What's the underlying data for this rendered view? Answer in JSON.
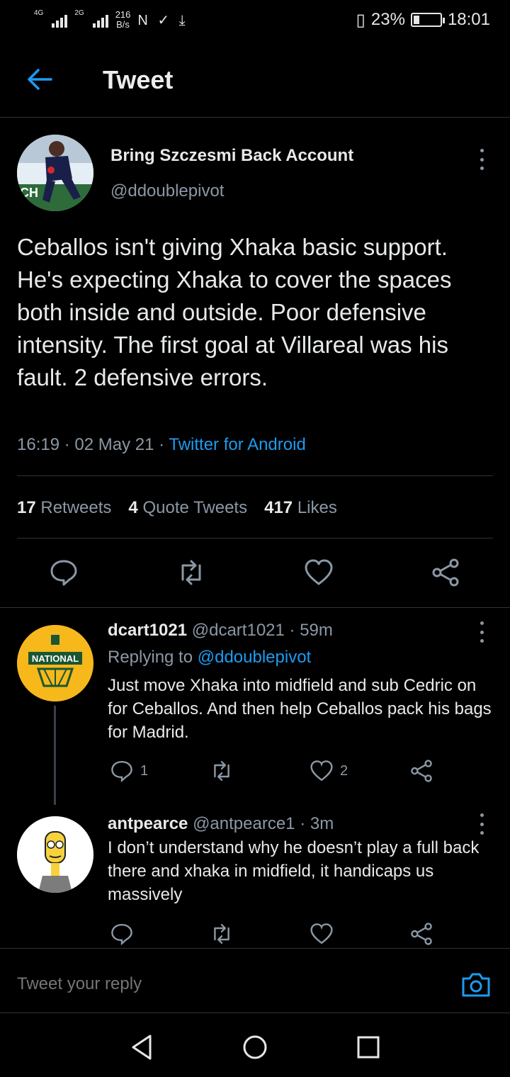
{
  "status_bar": {
    "signal_1": "4G",
    "signal_2": "2G",
    "net_speed": "216",
    "net_unit": "B/s",
    "notif_icons": "N ✓ ⤓",
    "battery_percent": "23%",
    "battery_level": 0.23,
    "time": "18:01"
  },
  "header": {
    "title": "Tweet"
  },
  "tweet": {
    "author_name": "Bring Szczesmi Back Account",
    "author_handle": "@ddoublepivot",
    "text": "Ceballos isn't giving Xhaka basic support. He's expecting Xhaka to cover the spaces both inside and outside. Poor defensive intensity. The first goal at Villareal was his fault. 2 defensive errors.",
    "time": "16:19",
    "date": "02 May 21",
    "source": "Twitter for Android",
    "stats": {
      "retweets_count": "17",
      "retweets_label": "Retweets",
      "quotes_count": "4",
      "quotes_label": "Quote Tweets",
      "likes_count": "417",
      "likes_label": "Likes"
    }
  },
  "replies": [
    {
      "name": "dcart1021",
      "handle": "@dcart1021",
      "age": "· 59m",
      "replying_prefix": "Replying to",
      "replying_to": "@ddoublepivot",
      "text": "Just move Xhaka into midfield and sub Cedric on for Ceballos.  And then help Ceballos pack his bags for Madrid.",
      "reply_count": "1",
      "like_count": "2"
    },
    {
      "name": "antpearce",
      "handle": "@antpearce1",
      "age": "· 3m",
      "text": "I don’t understand why he doesn’t play a full back there and xhaka in midfield, it handicaps us massively",
      "reply_count": "",
      "like_count": ""
    }
  ],
  "compose": {
    "placeholder": "Tweet your reply"
  },
  "colors": {
    "accent": "#1d9bf0",
    "muted": "#8b98a5",
    "text": "#e7e9ea",
    "background": "#000000"
  }
}
